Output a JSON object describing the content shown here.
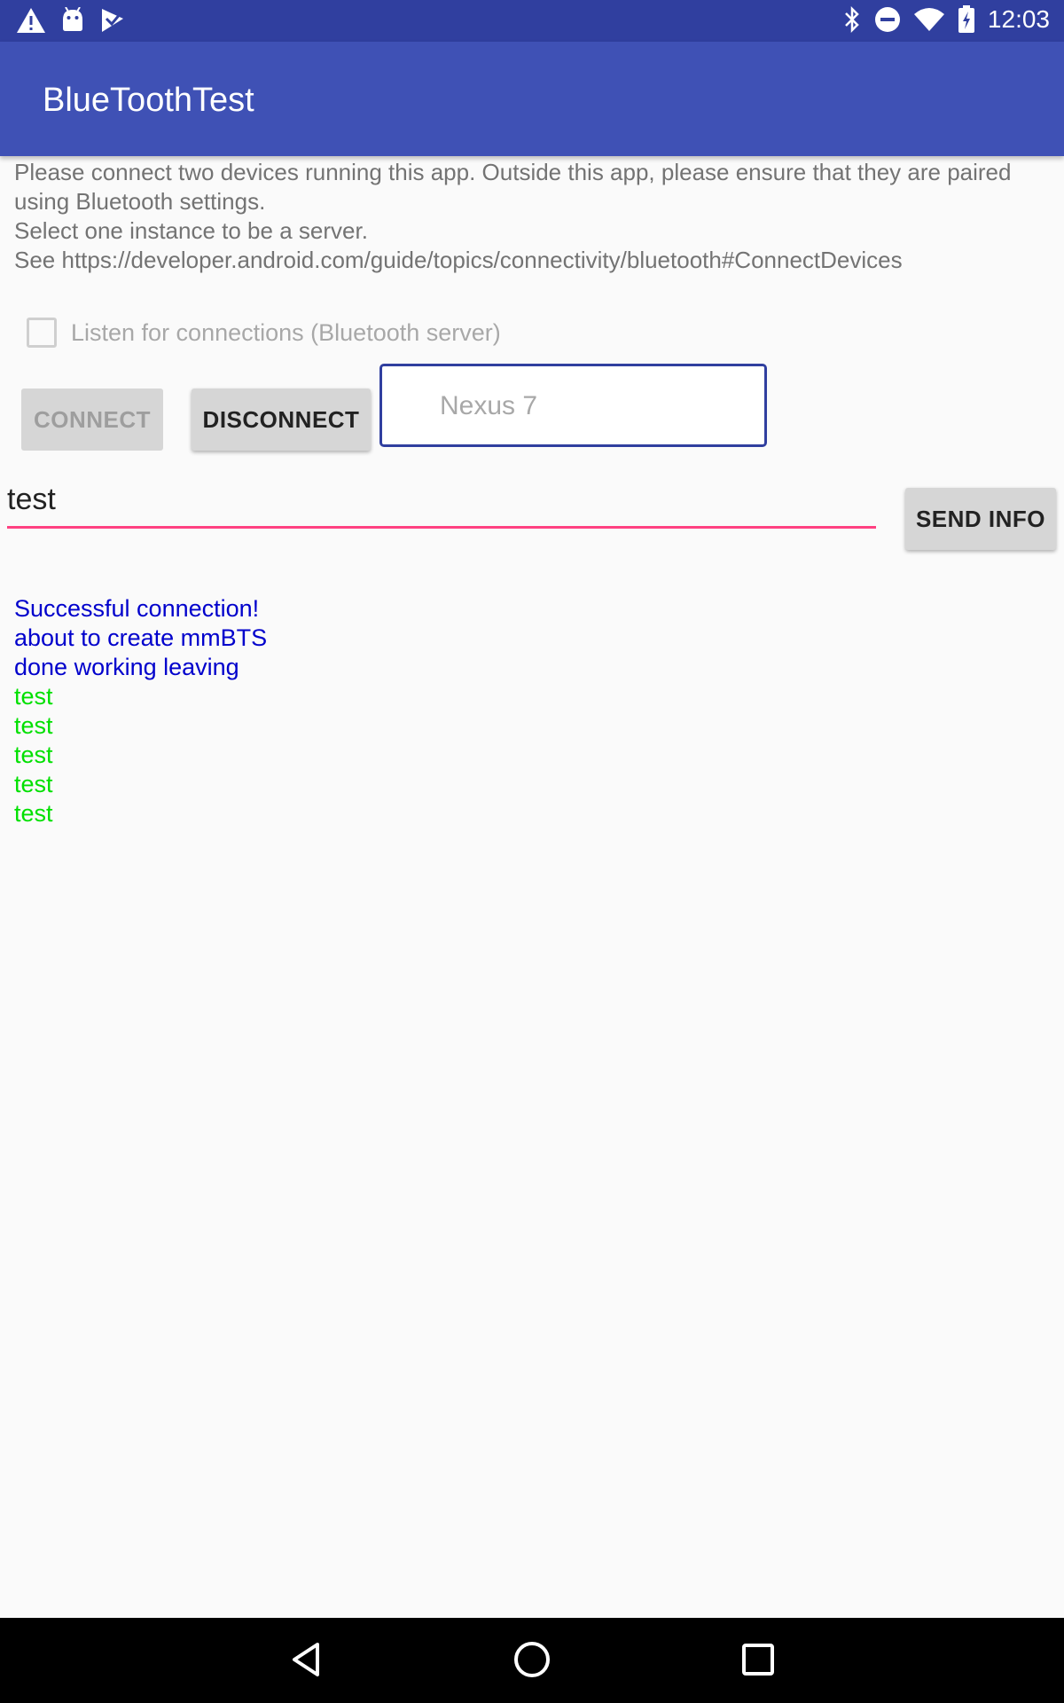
{
  "status_bar": {
    "time": "12:03",
    "left_icons": [
      "warning-icon",
      "android-debug-icon",
      "play-store-icon"
    ],
    "right_icons": [
      "bluetooth-icon",
      "do-not-disturb-icon",
      "wifi-icon",
      "battery-charging-icon"
    ]
  },
  "app_bar": {
    "title": "BlueToothTest"
  },
  "instructions": "Please connect two devices running this app. Outside this app, please ensure that they are paired using Bluetooth settings.\nSelect one instance to be a server.\n See https://developer.android.com/guide/topics/connectivity/bluetooth#ConnectDevices",
  "server_checkbox": {
    "label": "Listen for connections (Bluetooth server)",
    "checked": false
  },
  "buttons": {
    "connect": "CONNECT",
    "disconnect": "DISCONNECT",
    "send_info": "SEND INFO"
  },
  "device_selector": {
    "value": "Nexus 7"
  },
  "message_input": {
    "value": "test"
  },
  "log": [
    {
      "text": "Successful connection!",
      "color": "blue"
    },
    {
      "text": "about to create mmBTS",
      "color": "blue"
    },
    {
      "text": "done working leaving",
      "color": "blue"
    },
    {
      "text": "test",
      "color": "green"
    },
    {
      "text": "test",
      "color": "green"
    },
    {
      "text": "test",
      "color": "green"
    },
    {
      "text": "test",
      "color": "green"
    },
    {
      "text": "test",
      "color": "green"
    }
  ],
  "colors": {
    "status_bar": "#303f9f",
    "app_bar": "#3f51b5",
    "accent": "#ff4081",
    "log_blue": "#0000cc",
    "log_green": "#00e000"
  },
  "nav_bar": {
    "icons": [
      "back-icon",
      "home-icon",
      "recents-icon"
    ]
  }
}
